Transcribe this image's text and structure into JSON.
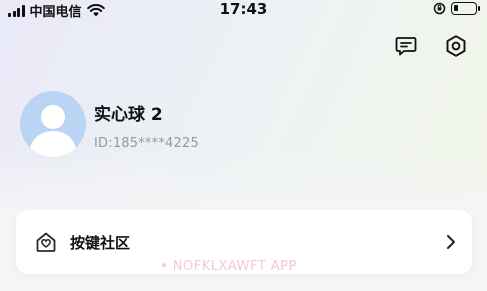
{
  "status_bar": {
    "carrier": "中国电信",
    "time": "17:43"
  },
  "header": {
    "icons": [
      "message-icon",
      "settings-icon"
    ]
  },
  "profile": {
    "name": "实心球 2",
    "id": "ID:185****4225"
  },
  "menu": {
    "items": [
      {
        "label": "按键社区",
        "icon": "community-home-icon"
      }
    ]
  },
  "watermark": "• NOFKLXAWFT APP",
  "colors": {
    "avatar_bg": "#b9d5f3",
    "text_primary": "#111111",
    "text_secondary": "#999999",
    "watermark": "#f3c7dd"
  }
}
